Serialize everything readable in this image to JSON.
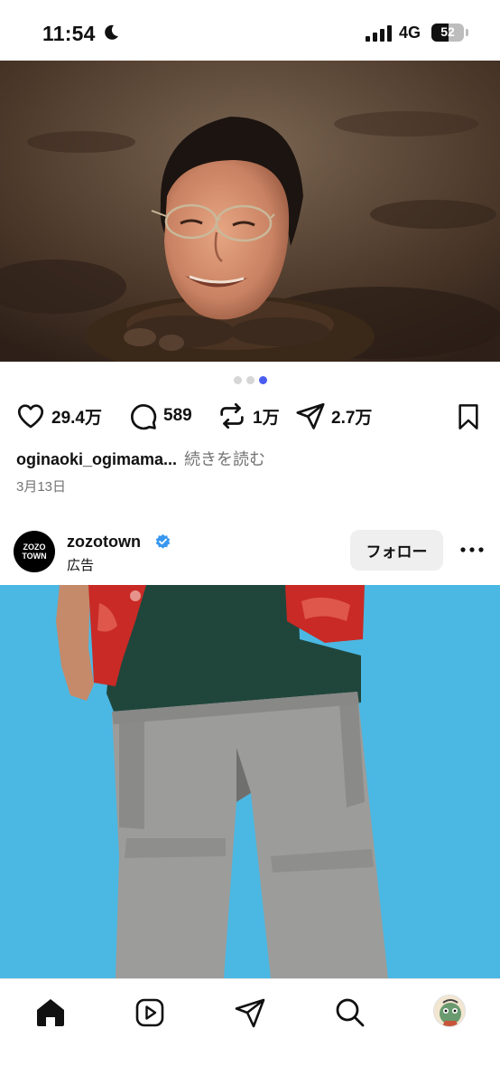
{
  "status_bar": {
    "time": "11:54",
    "network": "4G",
    "battery_level": "52",
    "icons": [
      "moon-icon",
      "signal-icon",
      "battery-icon"
    ]
  },
  "post1": {
    "carousel": {
      "count": 3,
      "active_index": 2,
      "active_color": "#4a5cf0"
    },
    "likes": "29.4万",
    "comments": "589",
    "reposts": "1万",
    "shares": "2.7万",
    "caption_user": "oginaoki_ogimama...",
    "caption_more": "続きを読む",
    "date": "3月13日"
  },
  "ad_post": {
    "avatar_line1": "ZOZO",
    "avatar_line2": "TOWN",
    "username": "zozotown",
    "label": "広告",
    "follow_label": "フォロー",
    "verified_color": "#3897f0"
  },
  "bottom_nav": {
    "items": [
      "home-icon",
      "reels-icon",
      "send-icon",
      "search-icon",
      "profile-avatar"
    ]
  }
}
